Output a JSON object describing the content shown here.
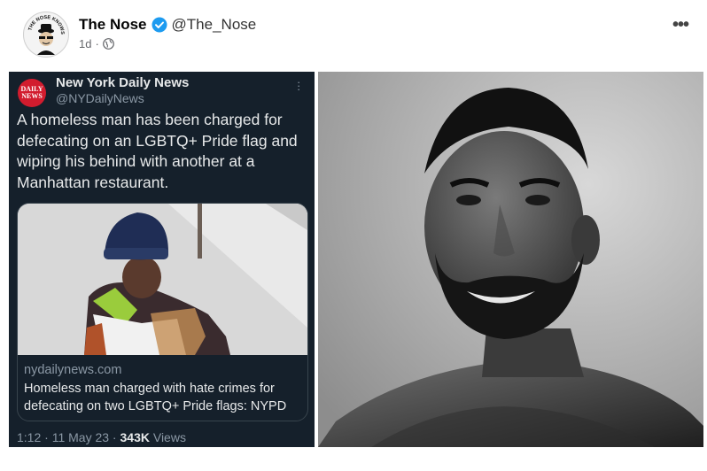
{
  "post": {
    "author_name": "The Nose",
    "author_handle": "@The_Nose",
    "time": "1d",
    "separator": "·",
    "avatar_text": "THE NOSE KNOWS",
    "more_label": "•••"
  },
  "tweet": {
    "account_name": "New York Daily News",
    "account_handle": "@NYDailyNews",
    "logo_line1": "DAILY",
    "logo_line2": "NEWS",
    "text": "A homeless man has been charged for defecating on an LGBTQ+ Pride flag and wiping his behind with another at a Manhattan restaurant.",
    "card_domain": "nydailynews.com",
    "card_headline": "Homeless man charged with hate crimes for defecating on two LGBTQ+ Pride flags: NYPD",
    "footer_time": "1:12",
    "footer_sep1": " · ",
    "footer_date": "11 May 23",
    "footer_sep2": " · ",
    "footer_views_count": "343K",
    "footer_views_label": " Views"
  },
  "colors": {
    "verified_blue": "#1d9bf0",
    "tweet_bg": "#15202b",
    "daily_news_red": "#d21c2e"
  },
  "icons": {
    "verified": "verified-badge-icon",
    "privacy": "globe-icon",
    "more": "more-options-icon"
  }
}
